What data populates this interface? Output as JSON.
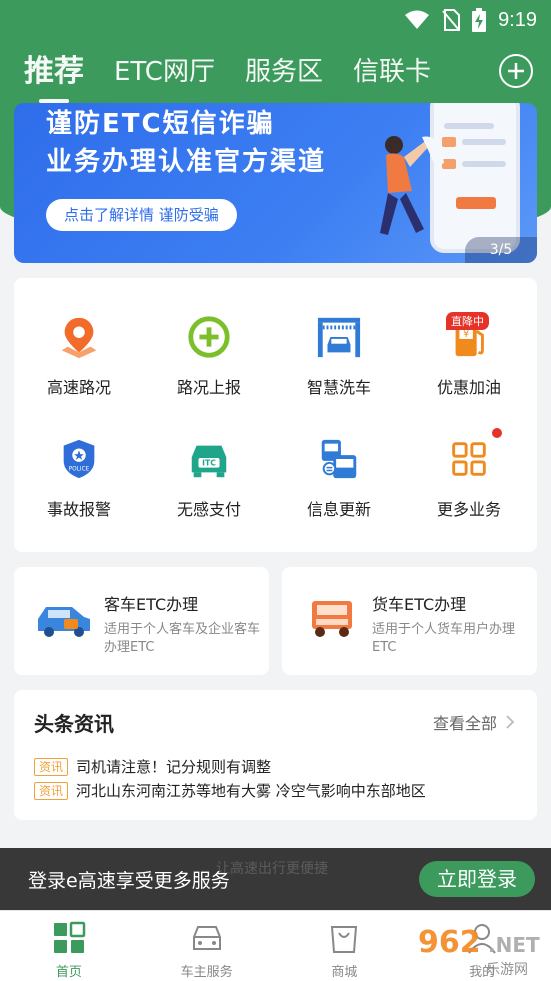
{
  "status_bar": {
    "time": "9:19"
  },
  "header": {
    "tabs": [
      {
        "label": "推荐"
      },
      {
        "label": "ETC网厅"
      },
      {
        "label": "服务区"
      },
      {
        "label": "信联卡"
      }
    ],
    "add_icon": "plus-circle-icon",
    "accent_color": "#3b9a5c"
  },
  "banner": {
    "line1": "谨防ETC短信诈骗",
    "line2": "业务办理认准官方渠道",
    "pill": "点击了解详情 谨防受骗",
    "page_indicator": "3/5"
  },
  "services": [
    {
      "label": "高速路况",
      "icon": "map-pin-icon"
    },
    {
      "label": "路况上报",
      "icon": "plus-circle-icon"
    },
    {
      "label": "智慧洗车",
      "icon": "car-wash-icon"
    },
    {
      "label": "优惠加油",
      "icon": "fuel-pump-icon",
      "badge": "直降中"
    },
    {
      "label": "事故报警",
      "icon": "police-badge-icon"
    },
    {
      "label": "无感支付",
      "icon": "itc-car-icon"
    },
    {
      "label": "信息更新",
      "icon": "vehicles-update-icon"
    },
    {
      "label": "更多业务",
      "icon": "grid-icon"
    }
  ],
  "etc_cards": [
    {
      "title": "客车ETC办理",
      "desc": "适用于个人客车及企业客车办理ETC",
      "icon": "passenger-car-icon"
    },
    {
      "title": "货车ETC办理",
      "desc": "适用于个人货车用户办理ETC",
      "icon": "truck-icon"
    }
  ],
  "news": {
    "title": "头条资讯",
    "more": "查看全部",
    "items": [
      {
        "tag": "资讯",
        "text": "司机请注意！记分规则有调整"
      },
      {
        "tag": "资讯",
        "text": "河北山东河南江苏等地有大雾 冷空气影响中东部地区"
      }
    ]
  },
  "login_bar": {
    "faint_text": "让高速出行更便捷",
    "text": "登录e高速享受更多服务",
    "button": "立即登录"
  },
  "bottom_nav": [
    {
      "label": "首页",
      "icon": "home-grid-icon"
    },
    {
      "label": "车主服务",
      "icon": "car-icon"
    },
    {
      "label": "商城",
      "icon": "shopping-bag-icon"
    },
    {
      "label": "我的",
      "icon": "person-icon"
    }
  ],
  "watermark": {
    "num": "962",
    "net": ".NET",
    "site": "乐游网"
  }
}
